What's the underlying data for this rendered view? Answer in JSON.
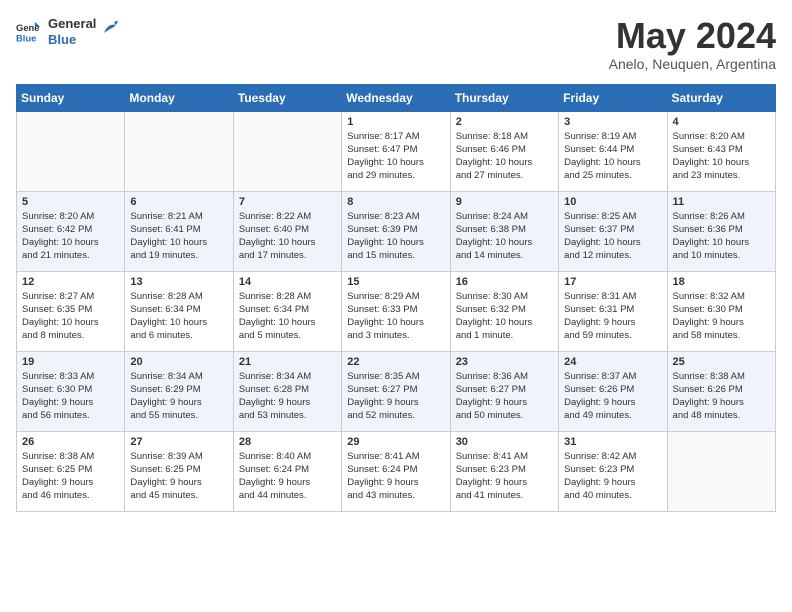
{
  "header": {
    "logo_general": "General",
    "logo_blue": "Blue",
    "title": "May 2024",
    "subtitle": "Anelo, Neuquen, Argentina"
  },
  "days_of_week": [
    "Sunday",
    "Monday",
    "Tuesday",
    "Wednesday",
    "Thursday",
    "Friday",
    "Saturday"
  ],
  "weeks": [
    [
      {
        "day": "",
        "info": ""
      },
      {
        "day": "",
        "info": ""
      },
      {
        "day": "",
        "info": ""
      },
      {
        "day": "1",
        "info": "Sunrise: 8:17 AM\nSunset: 6:47 PM\nDaylight: 10 hours\nand 29 minutes."
      },
      {
        "day": "2",
        "info": "Sunrise: 8:18 AM\nSunset: 6:46 PM\nDaylight: 10 hours\nand 27 minutes."
      },
      {
        "day": "3",
        "info": "Sunrise: 8:19 AM\nSunset: 6:44 PM\nDaylight: 10 hours\nand 25 minutes."
      },
      {
        "day": "4",
        "info": "Sunrise: 8:20 AM\nSunset: 6:43 PM\nDaylight: 10 hours\nand 23 minutes."
      }
    ],
    [
      {
        "day": "5",
        "info": "Sunrise: 8:20 AM\nSunset: 6:42 PM\nDaylight: 10 hours\nand 21 minutes."
      },
      {
        "day": "6",
        "info": "Sunrise: 8:21 AM\nSunset: 6:41 PM\nDaylight: 10 hours\nand 19 minutes."
      },
      {
        "day": "7",
        "info": "Sunrise: 8:22 AM\nSunset: 6:40 PM\nDaylight: 10 hours\nand 17 minutes."
      },
      {
        "day": "8",
        "info": "Sunrise: 8:23 AM\nSunset: 6:39 PM\nDaylight: 10 hours\nand 15 minutes."
      },
      {
        "day": "9",
        "info": "Sunrise: 8:24 AM\nSunset: 6:38 PM\nDaylight: 10 hours\nand 14 minutes."
      },
      {
        "day": "10",
        "info": "Sunrise: 8:25 AM\nSunset: 6:37 PM\nDaylight: 10 hours\nand 12 minutes."
      },
      {
        "day": "11",
        "info": "Sunrise: 8:26 AM\nSunset: 6:36 PM\nDaylight: 10 hours\nand 10 minutes."
      }
    ],
    [
      {
        "day": "12",
        "info": "Sunrise: 8:27 AM\nSunset: 6:35 PM\nDaylight: 10 hours\nand 8 minutes."
      },
      {
        "day": "13",
        "info": "Sunrise: 8:28 AM\nSunset: 6:34 PM\nDaylight: 10 hours\nand 6 minutes."
      },
      {
        "day": "14",
        "info": "Sunrise: 8:28 AM\nSunset: 6:34 PM\nDaylight: 10 hours\nand 5 minutes."
      },
      {
        "day": "15",
        "info": "Sunrise: 8:29 AM\nSunset: 6:33 PM\nDaylight: 10 hours\nand 3 minutes."
      },
      {
        "day": "16",
        "info": "Sunrise: 8:30 AM\nSunset: 6:32 PM\nDaylight: 10 hours\nand 1 minute."
      },
      {
        "day": "17",
        "info": "Sunrise: 8:31 AM\nSunset: 6:31 PM\nDaylight: 9 hours\nand 59 minutes."
      },
      {
        "day": "18",
        "info": "Sunrise: 8:32 AM\nSunset: 6:30 PM\nDaylight: 9 hours\nand 58 minutes."
      }
    ],
    [
      {
        "day": "19",
        "info": "Sunrise: 8:33 AM\nSunset: 6:30 PM\nDaylight: 9 hours\nand 56 minutes."
      },
      {
        "day": "20",
        "info": "Sunrise: 8:34 AM\nSunset: 6:29 PM\nDaylight: 9 hours\nand 55 minutes."
      },
      {
        "day": "21",
        "info": "Sunrise: 8:34 AM\nSunset: 6:28 PM\nDaylight: 9 hours\nand 53 minutes."
      },
      {
        "day": "22",
        "info": "Sunrise: 8:35 AM\nSunset: 6:27 PM\nDaylight: 9 hours\nand 52 minutes."
      },
      {
        "day": "23",
        "info": "Sunrise: 8:36 AM\nSunset: 6:27 PM\nDaylight: 9 hours\nand 50 minutes."
      },
      {
        "day": "24",
        "info": "Sunrise: 8:37 AM\nSunset: 6:26 PM\nDaylight: 9 hours\nand 49 minutes."
      },
      {
        "day": "25",
        "info": "Sunrise: 8:38 AM\nSunset: 6:26 PM\nDaylight: 9 hours\nand 48 minutes."
      }
    ],
    [
      {
        "day": "26",
        "info": "Sunrise: 8:38 AM\nSunset: 6:25 PM\nDaylight: 9 hours\nand 46 minutes."
      },
      {
        "day": "27",
        "info": "Sunrise: 8:39 AM\nSunset: 6:25 PM\nDaylight: 9 hours\nand 45 minutes."
      },
      {
        "day": "28",
        "info": "Sunrise: 8:40 AM\nSunset: 6:24 PM\nDaylight: 9 hours\nand 44 minutes."
      },
      {
        "day": "29",
        "info": "Sunrise: 8:41 AM\nSunset: 6:24 PM\nDaylight: 9 hours\nand 43 minutes."
      },
      {
        "day": "30",
        "info": "Sunrise: 8:41 AM\nSunset: 6:23 PM\nDaylight: 9 hours\nand 41 minutes."
      },
      {
        "day": "31",
        "info": "Sunrise: 8:42 AM\nSunset: 6:23 PM\nDaylight: 9 hours\nand 40 minutes."
      },
      {
        "day": "",
        "info": ""
      }
    ]
  ]
}
